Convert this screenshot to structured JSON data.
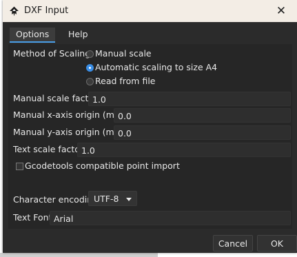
{
  "window": {
    "title": "DXF Input",
    "close_glyph": "✕"
  },
  "tabs": [
    {
      "label": "Options"
    },
    {
      "label": "Help"
    }
  ],
  "scaling": {
    "label": "Method of Scaling:",
    "options": [
      {
        "label": "Manual scale",
        "selected": false
      },
      {
        "label": "Automatic scaling to size A4",
        "selected": true
      },
      {
        "label": "Read from file",
        "selected": false
      }
    ]
  },
  "fields": {
    "manual_scale_factor": {
      "label": "Manual scale factor:",
      "value": "1.0"
    },
    "x_origin": {
      "label": "Manual x-axis origin (mm):",
      "value": "0.0"
    },
    "y_origin": {
      "label": "Manual y-axis origin (mm):",
      "value": "0.0"
    },
    "text_scale": {
      "label": "Text scale factor:",
      "value": "1.0"
    }
  },
  "gcode_checkbox": {
    "label": "Gcodetools compatible point import",
    "checked": false
  },
  "encoding": {
    "label": "Character encoding:",
    "value": "UTF-8"
  },
  "text_font": {
    "label": "Text Font:",
    "value": "Arial"
  },
  "buttons": {
    "cancel": "Cancel",
    "ok": "OK"
  }
}
